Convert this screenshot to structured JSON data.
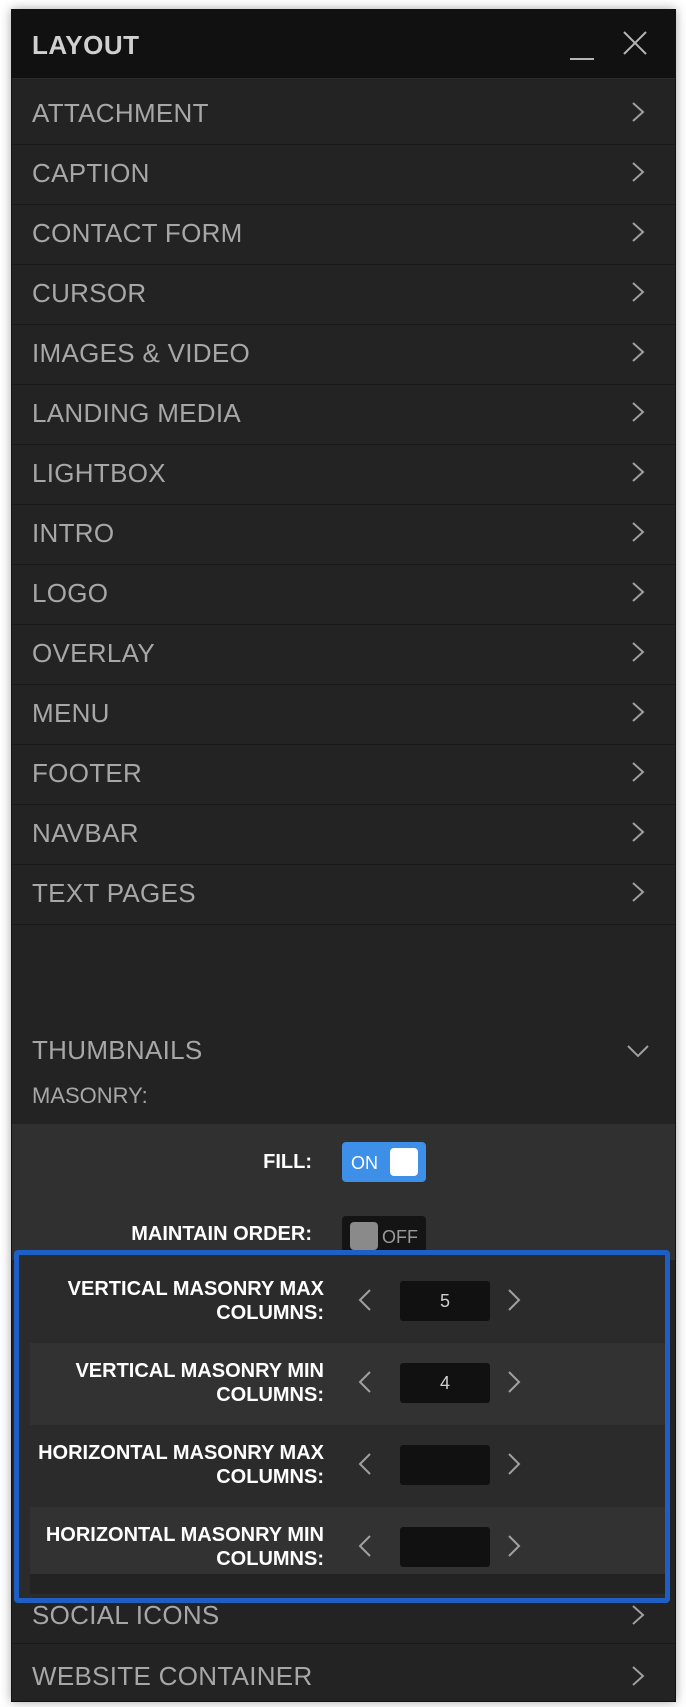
{
  "header": {
    "title": "LAYOUT"
  },
  "menu_items": [
    "ATTACHMENT",
    "CAPTION",
    "CONTACT FORM",
    "CURSOR",
    "IMAGES & VIDEO",
    "LANDING MEDIA",
    "LIGHTBOX",
    "INTRO",
    "LOGO",
    "OVERLAY",
    "MENU",
    "FOOTER",
    "NAVBAR",
    "TEXT PAGES",
    "THUMBNAILS"
  ],
  "thumbnails": {
    "section_label": "MASONRY:",
    "fill": {
      "label": "FILL:",
      "state": "ON"
    },
    "maintain_order": {
      "label": "MAINTAIN ORDER:",
      "state": "OFF"
    },
    "steppers": [
      {
        "label_line1": "VERTICAL MASONRY MAX",
        "label_line2": "COLUMNS:",
        "value": "5"
      },
      {
        "label_line1": "VERTICAL MASONRY MIN",
        "label_line2": "COLUMNS:",
        "value": "4"
      },
      {
        "label_line1": "HORIZONTAL MASONRY MAX",
        "label_line2": "COLUMNS:",
        "value": ""
      },
      {
        "label_line1": "HORIZONTAL MASONRY MIN",
        "label_line2": "COLUMNS:",
        "value": ""
      }
    ]
  },
  "bottom_items": [
    "SOCIAL ICONS",
    "WEBSITE CONTAINER"
  ],
  "colors": {
    "panel_bg": "#232323",
    "header_bg": "#111111",
    "accent_blue": "#3d8fe8",
    "highlight_border": "#1d5fc4"
  }
}
